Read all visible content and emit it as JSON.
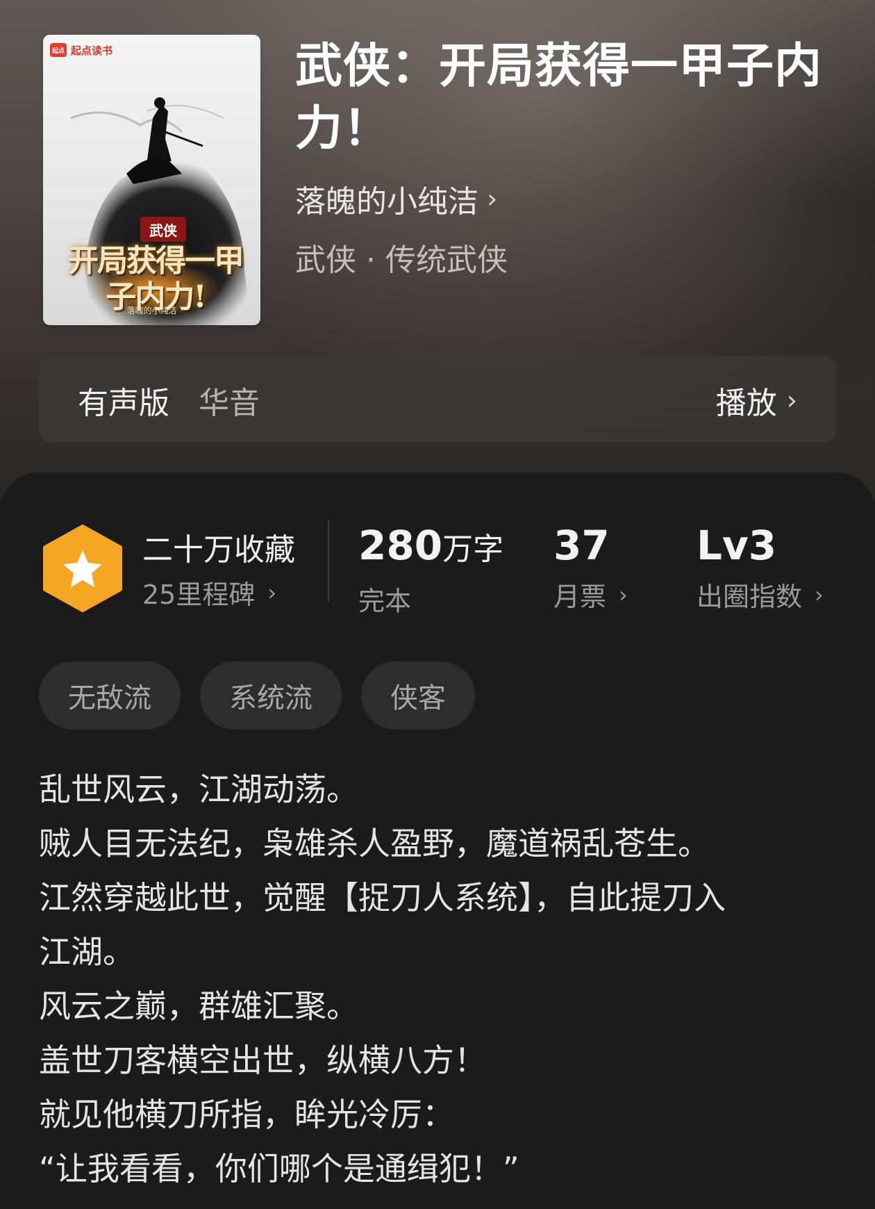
{
  "book": {
    "title": "武侠：开局获得一甲子内力！",
    "author": "落魄的小纯洁",
    "category": "武侠 · 传统武侠",
    "cover": {
      "brand": "起点读书",
      "brand_logo": "起点",
      "genre": "武侠",
      "title": "开局获得一甲子内力!",
      "author": "落魄的小纯洁"
    }
  },
  "audio": {
    "label": "有声版",
    "narrator": "华音",
    "play_label": "播放"
  },
  "stats": {
    "favorites": {
      "title": "二十万收藏",
      "subtitle": "25里程碑"
    },
    "words": {
      "value": "280",
      "unit": "万字",
      "label": "完本"
    },
    "monthly_votes": {
      "value": "37",
      "label": "月票"
    },
    "circle_index": {
      "value": "Lv3",
      "label": "出圈指数"
    }
  },
  "tags": [
    "无敌流",
    "系统流",
    "侠客"
  ],
  "intro_lines": [
    "乱世风云，江湖动荡。",
    "贼人目无法纪，枭雄杀人盈野，魔道祸乱苍生。",
    "江然穿越此世，觉醒【捉刀人系统】，自此提刀入",
    "江湖。",
    "风云之巅，群雄汇聚。",
    "盖世刀客横空出世，纵横八方！",
    "就见他横刀所指，眸光冷厉：",
    "“让我看看，你们哪个是通缉犯！”"
  ],
  "colors": {
    "badge": "#f5a623",
    "panel_bg": "#1b1b1b",
    "tag_bg": "#2d2d2d"
  },
  "icons": {
    "author_chevron": "chevron-right-icon",
    "badge": "star-icon"
  }
}
